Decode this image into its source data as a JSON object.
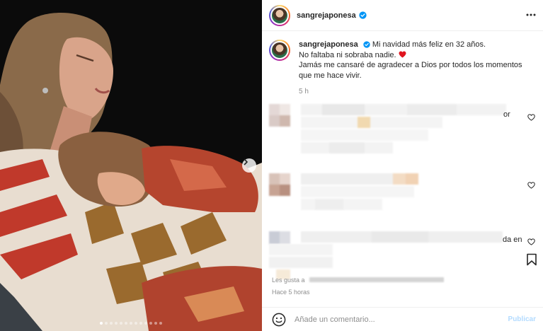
{
  "post": {
    "username": "sangrejaponesa",
    "caption_line1": "Mi navidad más feliz en 32 años.",
    "caption_line2": "No faltaba ni sobraba nadie.",
    "caption_line3": "Jamás me cansaré de agradecer a Dios por todos los momentos",
    "caption_line4": "que me hace vivir.",
    "time_ago": "5 h"
  },
  "comments": [
    {
      "visible_tail": "or"
    },
    {
      "visible_tail": ""
    },
    {
      "visible_tail": "da en"
    }
  ],
  "footer": {
    "likes_fragment": "Les gusta a",
    "hace": "Hace 5 horas"
  },
  "comment_box": {
    "placeholder": "Añade un comentario...",
    "publish_label": "Publicar"
  },
  "carousel": {
    "slide_count": 13,
    "active_index": 0
  },
  "colors": {
    "verified_blue": "#0095f6",
    "heart_red": "#ed4956",
    "publish_disabled": "#b3dbff"
  },
  "icons": {
    "verified": "verified-badge-icon",
    "more": "more-options-icon",
    "like": "heart-outline-icon",
    "bookmark": "bookmark-icon",
    "emoji": "smiley-icon",
    "next": "chevron-right-icon"
  }
}
